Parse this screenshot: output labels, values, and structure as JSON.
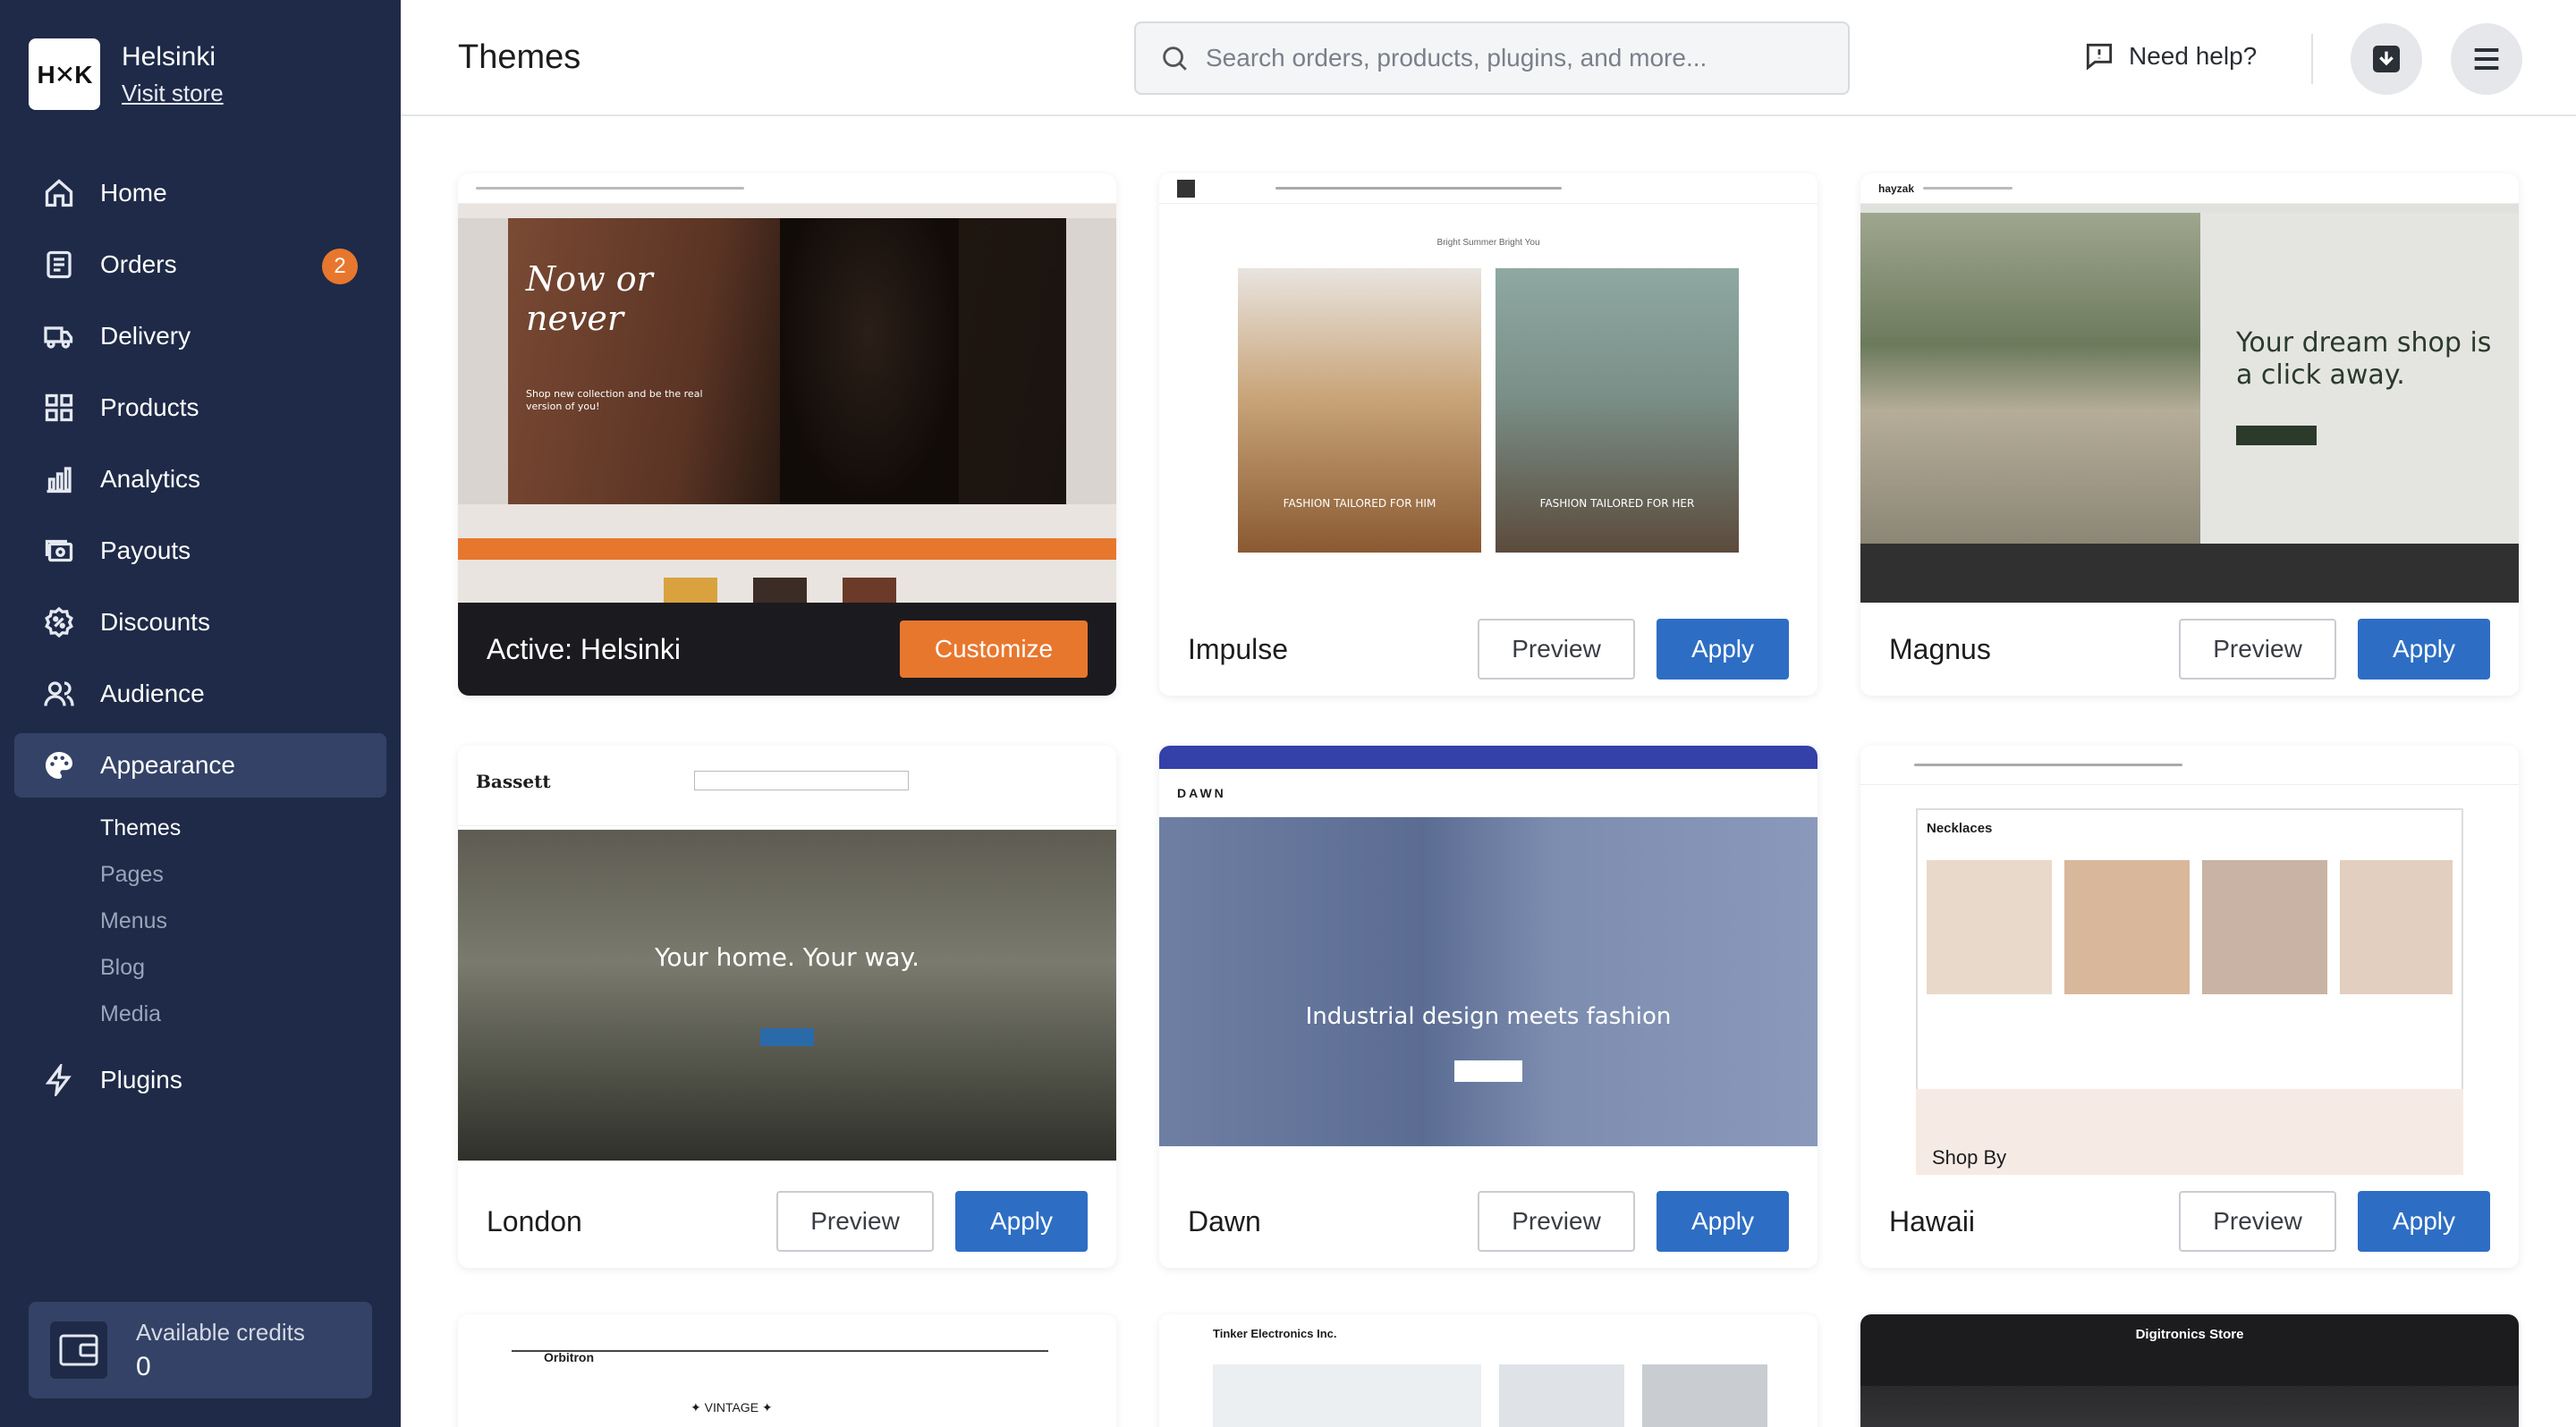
{
  "store": {
    "logo": "H✕K",
    "name": "Helsinki",
    "visit_label": "Visit store"
  },
  "nav": {
    "items": [
      {
        "label": "Home",
        "icon": "home-icon"
      },
      {
        "label": "Orders",
        "icon": "orders-icon",
        "badge": "2"
      },
      {
        "label": "Delivery",
        "icon": "truck-icon"
      },
      {
        "label": "Products",
        "icon": "grid-icon"
      },
      {
        "label": "Analytics",
        "icon": "chart-icon"
      },
      {
        "label": "Payouts",
        "icon": "payout-icon"
      },
      {
        "label": "Discounts",
        "icon": "discount-icon"
      },
      {
        "label": "Audience",
        "icon": "users-icon"
      },
      {
        "label": "Appearance",
        "icon": "palette-icon"
      },
      {
        "label": "Plugins",
        "icon": "bolt-icon"
      }
    ],
    "subnav": [
      "Themes",
      "Pages",
      "Menus",
      "Blog",
      "Media"
    ]
  },
  "credits": {
    "label": "Available credits",
    "value": "0"
  },
  "topbar": {
    "title": "Themes",
    "search_placeholder": "Search orders, products, plugins, and more...",
    "help_label": "Need help?"
  },
  "themes": [
    {
      "name": "Active: Helsinki",
      "action": "Customize",
      "hero_text": "Now or never",
      "hero_sub": "Shop new collection and be the real version of you!"
    },
    {
      "name": "Impulse",
      "preview": "Preview",
      "apply": "Apply",
      "caption_left": "FASHION TAILORED FOR HIM",
      "caption_right": "FASHION TAILORED FOR HER",
      "top_text": "Bright Summer Bright You"
    },
    {
      "name": "Magnus",
      "preview": "Preview",
      "apply": "Apply",
      "hero_text": "Your dream shop is a click away.",
      "logo": "hayzak"
    },
    {
      "name": "London",
      "preview": "Preview",
      "apply": "Apply",
      "hero_text": "Your home. Your way.",
      "logo": "Bassett"
    },
    {
      "name": "Dawn",
      "preview": "Preview",
      "apply": "Apply",
      "hero_text": "Industrial design meets fashion",
      "logo": "DAWN"
    },
    {
      "name": "Hawaii",
      "preview": "Preview",
      "apply": "Apply",
      "section": "Necklaces",
      "shop_by": "Shop By"
    },
    {
      "logo": "Orbitron",
      "hero_text": "✦ VINTAGE ✦"
    },
    {
      "logo": "Tinker Electronics Inc."
    },
    {
      "logo": "Digitronics Store"
    }
  ]
}
